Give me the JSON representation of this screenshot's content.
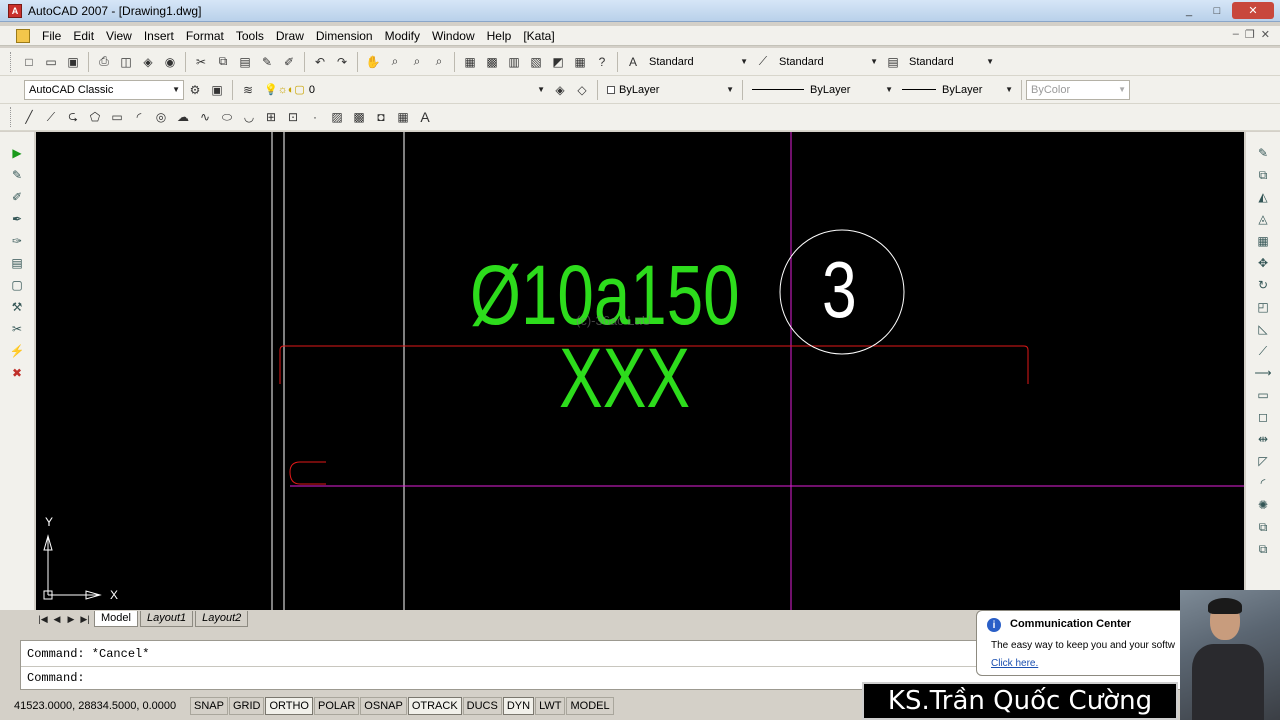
{
  "window": {
    "title": "AutoCAD 2007 - [Drawing1.dwg]",
    "icon": "autocad-icon",
    "controls": [
      "_",
      "□",
      "✕"
    ]
  },
  "menu": [
    "File",
    "Edit",
    "View",
    "Insert",
    "Format",
    "Tools",
    "Draw",
    "Dimension",
    "Modify",
    "Window",
    "Help",
    "[Kata]"
  ],
  "styles_toolbar": {
    "text_style": "Standard",
    "dim_style": "Standard",
    "table_style": "Standard"
  },
  "workspace": "AutoCAD Classic",
  "layer": {
    "current": "0"
  },
  "properties": {
    "color": "ByLayer",
    "linetype": "ByLayer",
    "lineweight": "ByLayer",
    "plotstyle": "ByColor"
  },
  "drawing": {
    "dimension_text": "Ø10a150",
    "sub_text": "XXX",
    "circle_label": "3",
    "faint_text": "(с)-36ас LаU",
    "ucs_y": "Y",
    "ucs_x": "X",
    "colors": {
      "background": "#000000",
      "text": "#2ddc1c",
      "red_line": "#e01818",
      "magenta_line": "#e020d8",
      "white_line": "#ffffff"
    }
  },
  "tabs": [
    "Model",
    "Layout1",
    "Layout2"
  ],
  "command": {
    "history": "Command: *Cancel*",
    "prompt": "Command:"
  },
  "status": {
    "coords": "41523.0000, 28834.5000, 0.0000",
    "buttons": [
      "SNAP",
      "GRID",
      "ORTHO",
      "POLAR",
      "OSNAP",
      "OTRACK",
      "DUCS",
      "DYN",
      "LWT",
      "MODEL"
    ]
  },
  "communication_center": {
    "title": "Communication Center",
    "body": "The easy way to keep you and your softw",
    "link": "Click here."
  },
  "author": "KS.Trần Quốc Cường"
}
